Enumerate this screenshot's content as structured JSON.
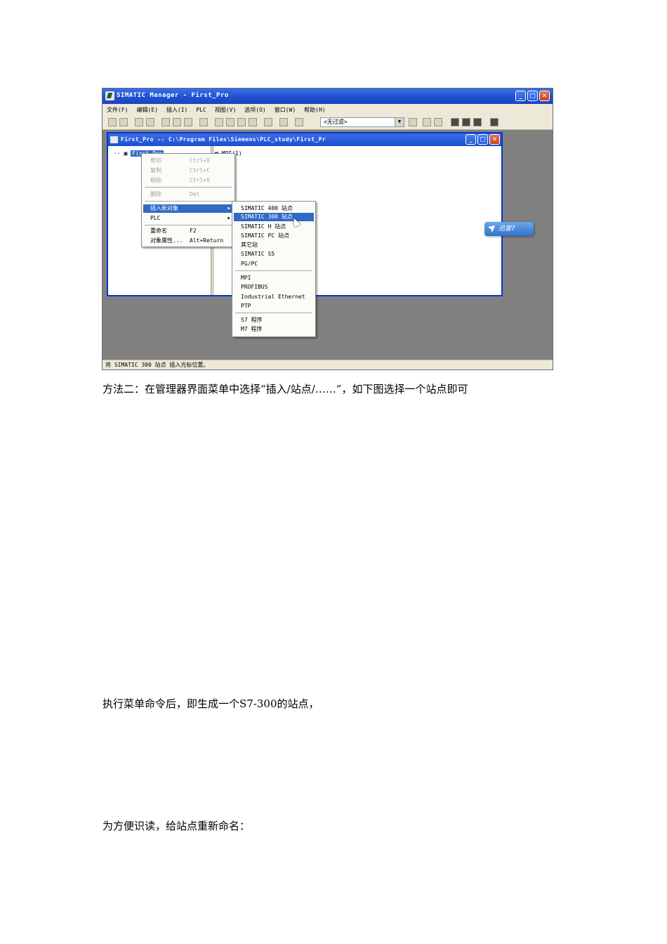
{
  "screenshot": {
    "window_title": "SIMATIC Manager - First_Pro",
    "menu": [
      "文件(F)",
      "编辑(E)",
      "插入(I)",
      "PLC",
      "视图(V)",
      "选项(O)",
      "窗口(W)",
      "帮助(H)"
    ],
    "filter_value": "<无过滤>",
    "child_title": "First_Pro -- C:\\Program Files\\Siemens\\PLC_study\\First_Pr",
    "tree_item": "First_Pro",
    "right_item": "MPI(1)",
    "context_menu": [
      {
        "label": "剪切",
        "shortcut": "Ctrl+X",
        "disabled": true
      },
      {
        "label": "复制",
        "shortcut": "Ctrl+C",
        "disabled": true
      },
      {
        "label": "粘贴",
        "shortcut": "Ctrl+V",
        "disabled": true
      },
      {
        "label": "删除",
        "shortcut": "Del",
        "disabled": true
      },
      {
        "label": "插入新对象",
        "shortcut": "",
        "highlighted": true,
        "submenu": true
      },
      {
        "label": "PLC",
        "shortcut": "",
        "submenu": true
      },
      {
        "label": "重命名",
        "shortcut": "F2"
      },
      {
        "label": "对象属性...",
        "shortcut": "Alt+Return"
      }
    ],
    "submenu": [
      "SIMATIC 400 站点",
      "SIMATIC 300 站点",
      "SIMATIC H 站点",
      "SIMATIC PC 站点",
      "其它站",
      "SIMATIC S5",
      "PG/PC",
      "MPI",
      "PROFIBUS",
      "Industrial Ethernet",
      "PTP",
      "S7 程序",
      "M7 程序"
    ],
    "badge": "迅雷7",
    "status": "将 SIMATIC 300 站点 插入光标位置。"
  },
  "paragraphs": {
    "p1": "方法二：在管理器界面菜单中选择“插入/站点/……”，如下图选择一个站点即可",
    "p2": "执行菜单命令后，即生成一个S7-300的站点，",
    "p3": "为方便识读，给站点重新命名："
  }
}
